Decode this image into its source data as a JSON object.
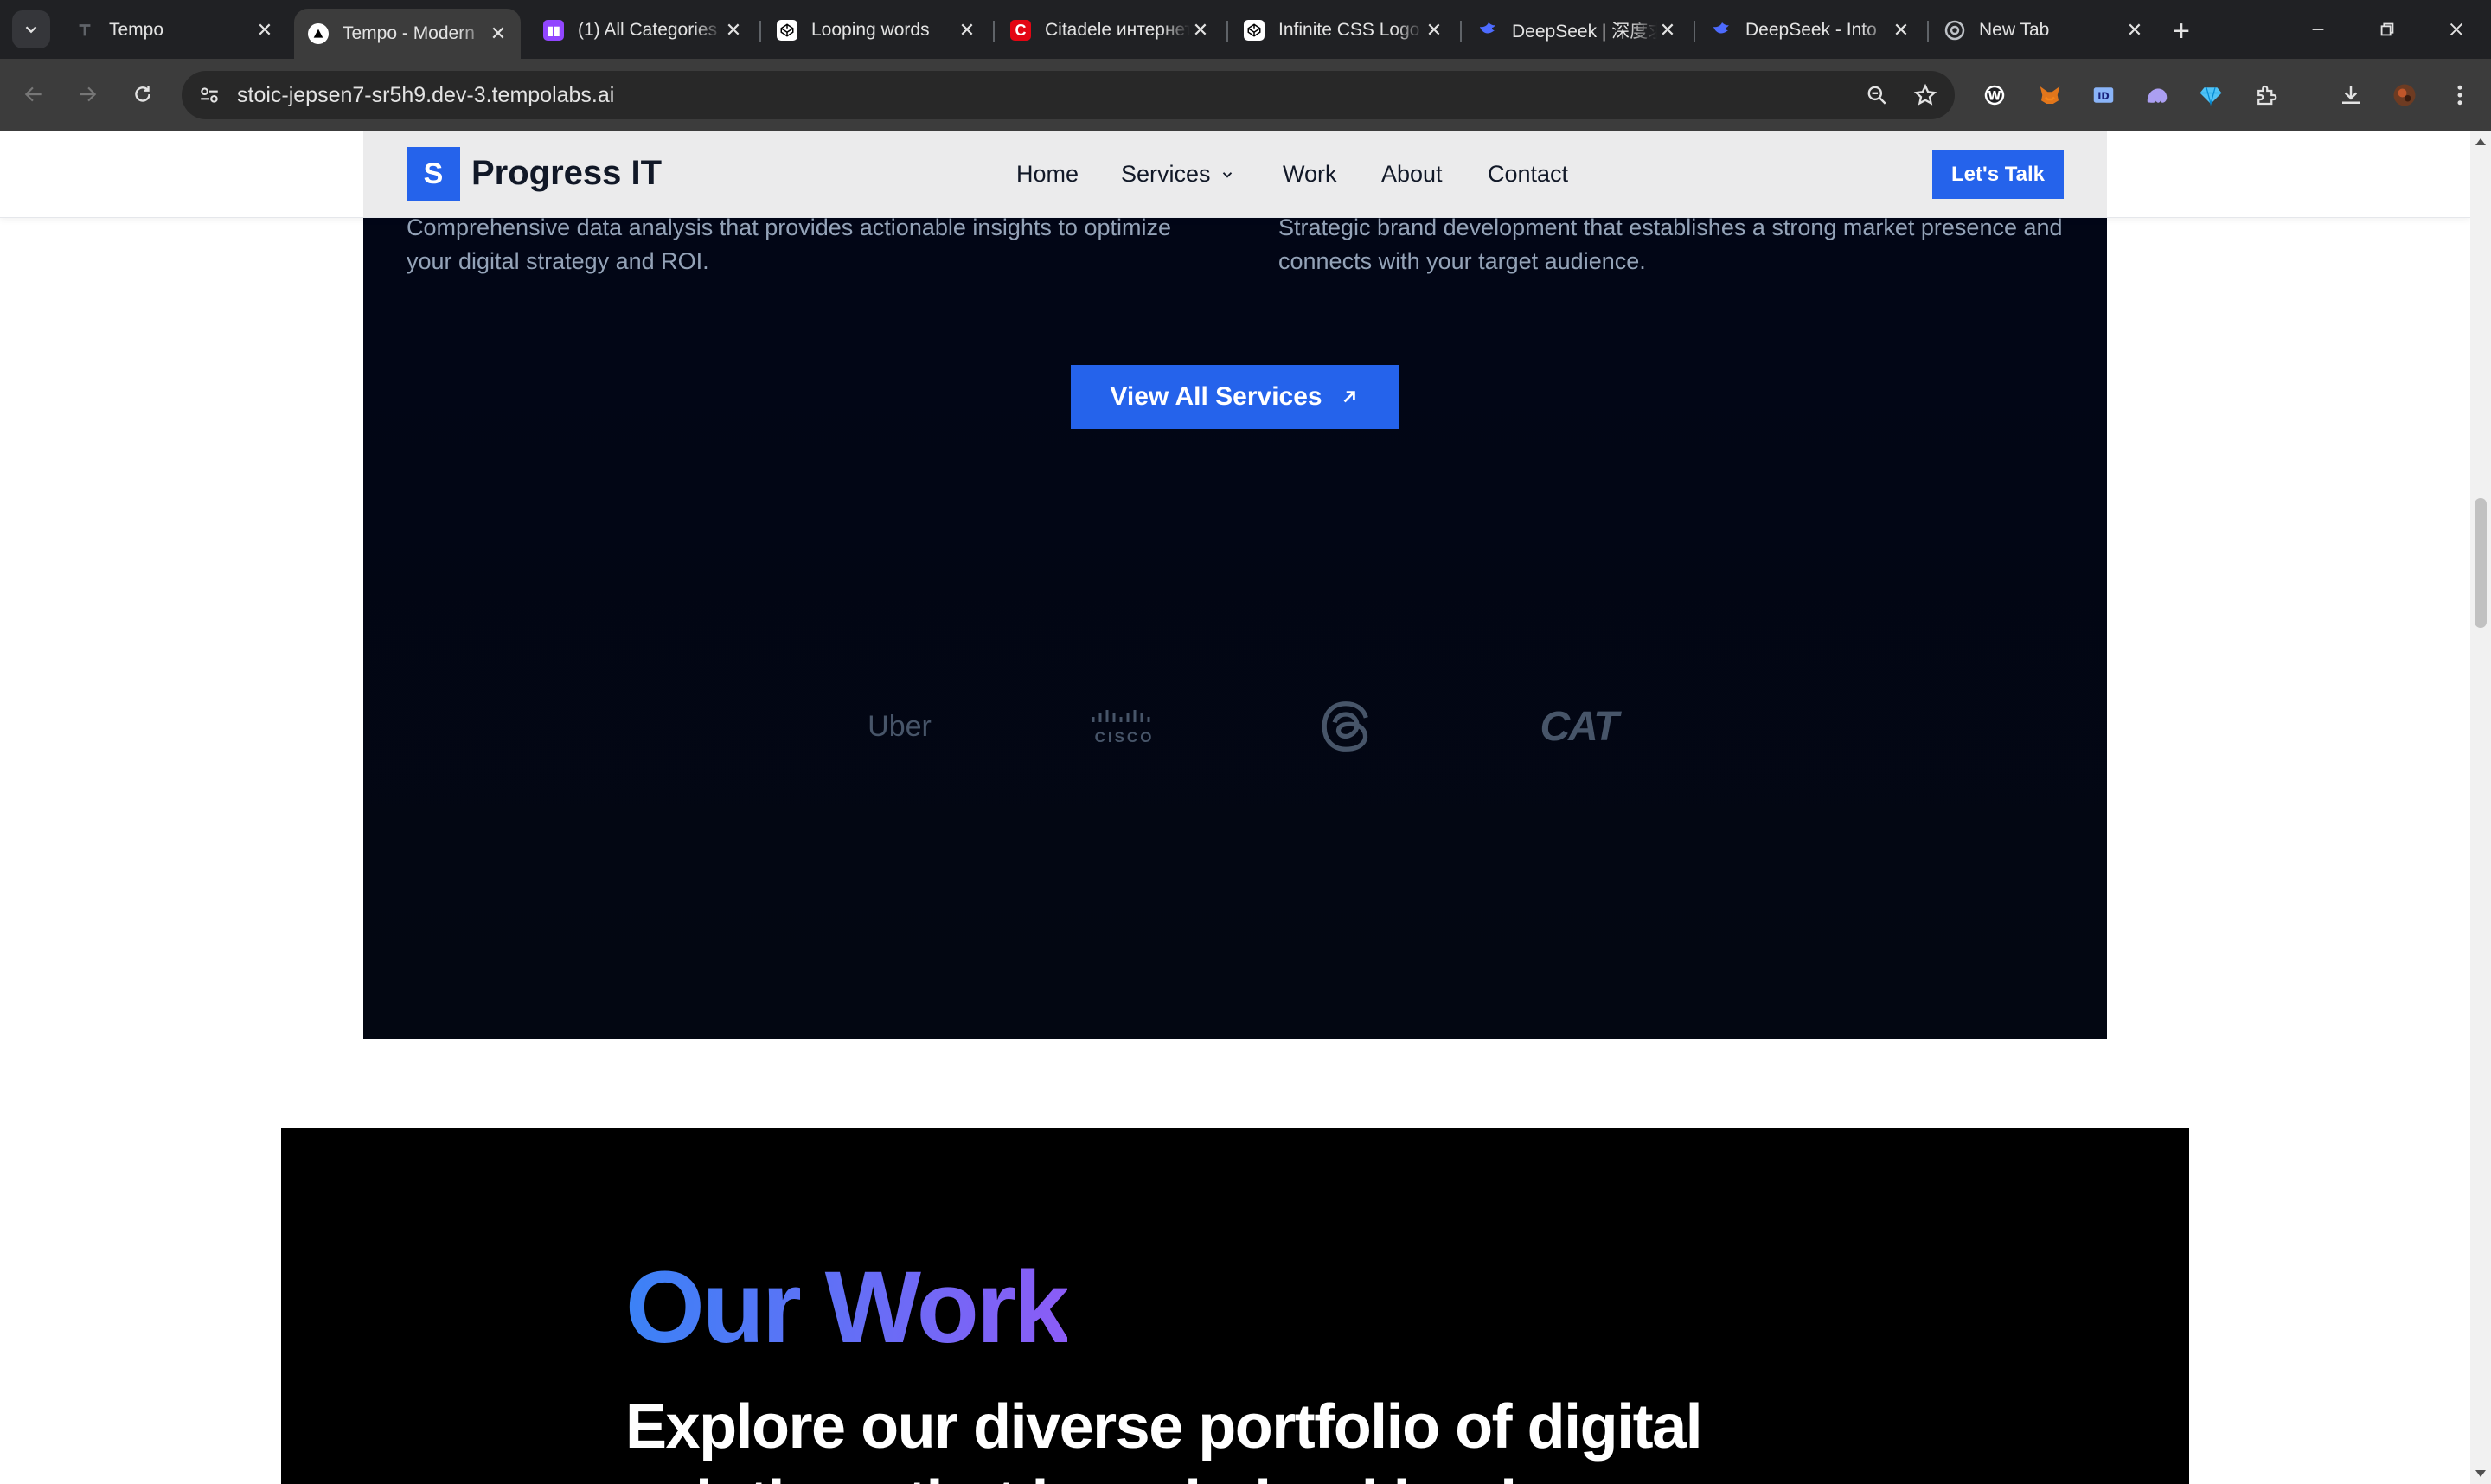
{
  "browser": {
    "tabs": [
      {
        "title": "Tempo",
        "favicon": "tempo-icon",
        "active": false
      },
      {
        "title": "Tempo - Modern",
        "favicon": "tempo-triangle-icon",
        "active": true
      },
      {
        "title": "(1) All Categories",
        "favicon": "twitch-icon",
        "active": false
      },
      {
        "title": "Looping words",
        "favicon": "codepen-icon",
        "active": false
      },
      {
        "title": "Citadele интернет",
        "favicon": "citadele-icon",
        "active": false
      },
      {
        "title": "Infinite CSS Logo",
        "favicon": "codepen-icon",
        "active": false
      },
      {
        "title": "DeepSeek | 深度求索",
        "favicon": "deepseek-icon",
        "active": false
      },
      {
        "title": "DeepSeek - Into",
        "favicon": "deepseek-icon",
        "active": false
      },
      {
        "title": "New Tab",
        "favicon": "chrome-icon",
        "active": false
      }
    ],
    "url": "stoic-jepsen7-sr5h9.dev-3.tempolabs.ai"
  },
  "header": {
    "brand_letter": "S",
    "brand_name": "Progress IT",
    "nav": {
      "home": "Home",
      "services": "Services",
      "work": "Work",
      "about": "About",
      "contact": "Contact"
    },
    "cta": "Let's Talk"
  },
  "services": {
    "desc_left": "Comprehensive data analysis that provides actionable insights to optimize your digital strategy and ROI.",
    "desc_right": "Strategic brand development that establishes a strong market presence and connects with your target audience.",
    "view_all": "View All Services",
    "logos": [
      "Uber",
      "CISCO",
      "threads-logo",
      "CAT"
    ]
  },
  "work": {
    "title": "Our Work",
    "subtitle": "Explore our diverse portfolio of digital solutions that have helped businesses"
  },
  "colors": {
    "accent": "#2563eb",
    "dark_bg": "#020617",
    "gradient_start": "#3b82f6",
    "gradient_end": "#8b5cf6"
  }
}
